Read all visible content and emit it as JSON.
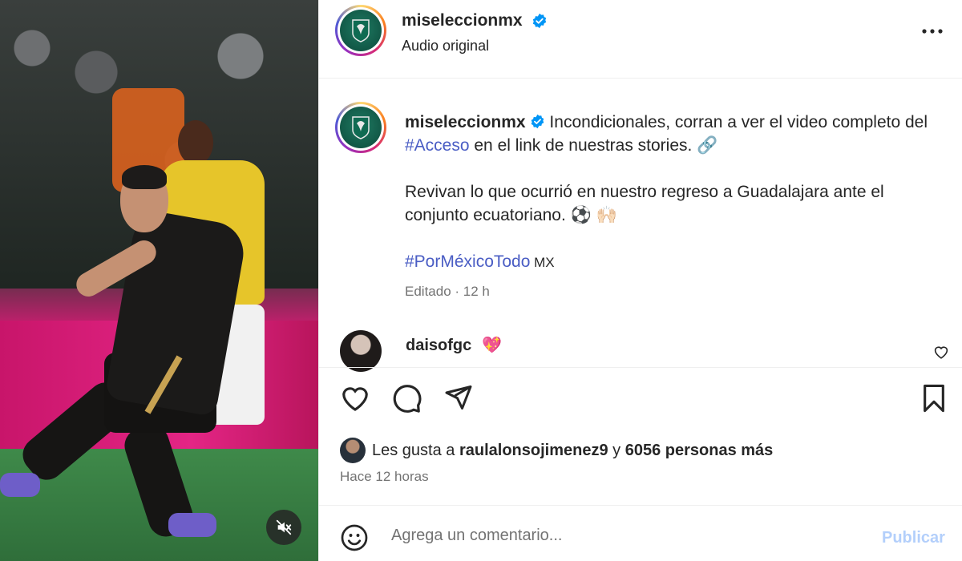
{
  "media": {
    "mute_icon": "speaker-muted-icon"
  },
  "header": {
    "username": "miseleccionmx",
    "subtitle": "Audio original",
    "more_icon": "more-horizontal-icon"
  },
  "caption": {
    "username": "miseleccionmx",
    "text_1": " Incondicionales, corran a ver el video completo del ",
    "hashtag_1": "#Acceso",
    "text_2": " en el link de nuestras stories. ",
    "link_emoji": "🔗",
    "paragraph_2": "Revivan lo que ocurrió en nuestro regreso a Guadalajara ante el conjunto ecuatoriano. ",
    "paragraph_2_emojis": "⚽ 🙌🏻",
    "hashtag_2": "#PorMéxicoTodo",
    "flag_text": " MX",
    "meta": "Editado · 12 h"
  },
  "comment": {
    "username": "daisofgc",
    "emoji": "💖"
  },
  "likes": {
    "prefix": "Les gusta a ",
    "user": "raulalonsojimenez9",
    "middle": " y ",
    "others": "6056 personas más"
  },
  "time_ago": "Hace 12 horas",
  "comment_box": {
    "placeholder": "Agrega un comentario...",
    "publish": "Publicar"
  },
  "colors": {
    "hashtag": "#4a5dc4",
    "verified": "#0095f6",
    "publish_disabled": "#b3cffb",
    "muted_text": "#737373"
  }
}
